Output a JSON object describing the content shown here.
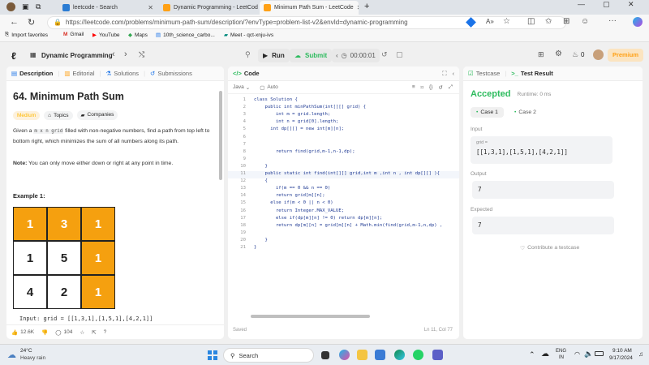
{
  "browser": {
    "tabs": [
      {
        "label": "leetcode - Search"
      },
      {
        "label": "Dynamic Programming - LeetCod"
      },
      {
        "label": "Minimum Path Sum - LeetCode"
      }
    ],
    "url": "https://leetcode.com/problems/minimum-path-sum/description/?envType=problem-list-v2&envId=dynamic-programming",
    "bookmarks": [
      "Import favorites",
      "Gmail",
      "YouTube",
      "Maps",
      "10th_science_carbo...",
      "Meet - qct-xnju-ivs"
    ]
  },
  "leetcode_nav": {
    "list_title": "Dynamic Programming",
    "run_label": "Run",
    "submit_label": "Submit",
    "timer": "00:00:01",
    "streak_count": "0",
    "premium_label": "Premium"
  },
  "description_panel": {
    "tabs": [
      "Description",
      "Editorial",
      "Solutions",
      "Submissions"
    ],
    "title": "64. Minimum Path Sum",
    "difficulty": "Medium",
    "topics_label": "Topics",
    "companies_label": "Companies",
    "para1_a": "Given a",
    "para1_code": "m x n grid",
    "para1_b": "filled with non-negative numbers, find a path from top left to bottom right, which minimizes the sum of all numbers along its path.",
    "note_bold": "Note:",
    "note_text": "You can only move either down or right at any point in time.",
    "example_label": "Example 1:",
    "grid": [
      [
        "1",
        "3",
        "1"
      ],
      [
        "1",
        "5",
        "1"
      ],
      [
        "4",
        "2",
        "1"
      ]
    ],
    "input_line": "Input: grid = [[1,3,1],[1,5,1],[4,2,1]]",
    "likes": "12.6K",
    "comments": "104"
  },
  "code_panel": {
    "title": "Code",
    "language": "Java",
    "mode": "Auto",
    "lines": [
      "class Solution {",
      "    public int minPathSum(int[][] grid) {",
      "        int m = grid.length;",
      "        int n = grid[0].length;",
      "      int dp[][] = new int[m][n];",
      "",
      "",
      "        return find(grid,m-1,n-1,dp);",
      "",
      "    }",
      "    public static int find(int[][] grid,int m ,int n , int dp[][] ){",
      "    {",
      "        if(m == 0 && n == 0)",
      "        return grid[m][n];",
      "      else if(m < 0 || n < 0)",
      "        return Integer.MAX_VALUE;",
      "        else if(dp[m][n] != 0) return dp[m][n];",
      "        return dp[m][n] = grid[m][n] + Math.min(find(grid,m-1,n,dp) ,",
      "",
      "    }",
      "}"
    ],
    "status_left": "Saved",
    "status_right": "Ln 11, Col 77"
  },
  "result_panel": {
    "tab_testcase": "Testcase",
    "tab_result": "Test Result",
    "status": "Accepted",
    "runtime": "Runtime: 0 ms",
    "cases": [
      "Case 1",
      "Case 2"
    ],
    "input_label": "Input",
    "input_var": "grid =",
    "input_value": "[[1,3,1],[1,5,1],[4,2,1]]",
    "output_label": "Output",
    "output_value": "7",
    "expected_label": "Expected",
    "expected_value": "7",
    "contribute_label": "Contribute a testcase"
  },
  "taskbar": {
    "weather_temp": "24°C",
    "weather_desc": "Heavy rain",
    "search_label": "Search",
    "lang_top": "ENG",
    "lang_bottom": "IN",
    "time": "9:10 AM",
    "date": "9/17/2024"
  },
  "colors": {
    "accent_orange": "#ffa116",
    "accepted_green": "#2cbb5d",
    "grid_orange": "#f5a00f"
  }
}
